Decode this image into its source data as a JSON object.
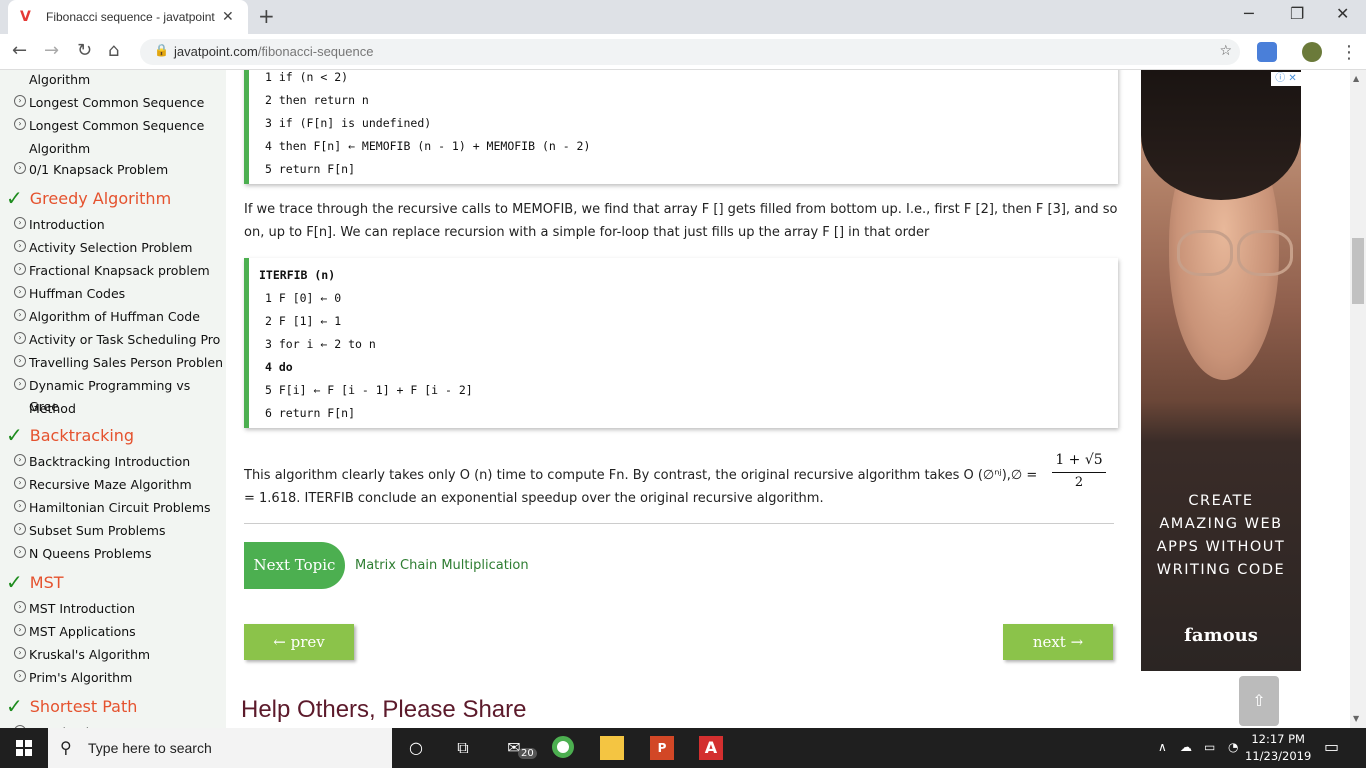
{
  "browser": {
    "tab_title": "Fibonacci sequence - javatpoint",
    "favicon": "V",
    "url_host": "javatpoint.com",
    "url_path": "/fibonacci-sequence"
  },
  "sidebar": {
    "items": [
      {
        "kind": "cont",
        "text": "Algorithm"
      },
      {
        "kind": "item",
        "text": "Longest Common Sequence"
      },
      {
        "kind": "item",
        "text": "Longest Common Sequence"
      },
      {
        "kind": "cont",
        "text": "Algorithm"
      },
      {
        "kind": "item",
        "text": "0/1 Knapsack Problem"
      },
      {
        "kind": "head",
        "text": "Greedy Algorithm"
      },
      {
        "kind": "item",
        "text": "Introduction"
      },
      {
        "kind": "item",
        "text": "Activity Selection Problem"
      },
      {
        "kind": "item",
        "text": "Fractional Knapsack problem"
      },
      {
        "kind": "item",
        "text": "Huffman Codes"
      },
      {
        "kind": "item",
        "text": "Algorithm of Huffman Code"
      },
      {
        "kind": "item",
        "text": "Activity or Task Scheduling Pro"
      },
      {
        "kind": "item",
        "text": "Travelling Sales Person Problen"
      },
      {
        "kind": "item",
        "text": "Dynamic Programming vs Gree"
      },
      {
        "kind": "cont",
        "text": "Method"
      },
      {
        "kind": "head",
        "text": "Backtracking"
      },
      {
        "kind": "item",
        "text": "Backtracking Introduction"
      },
      {
        "kind": "item",
        "text": "Recursive Maze Algorithm"
      },
      {
        "kind": "item",
        "text": "Hamiltonian Circuit Problems"
      },
      {
        "kind": "item",
        "text": "Subset Sum Problems"
      },
      {
        "kind": "item",
        "text": "N Queens Problems"
      },
      {
        "kind": "head",
        "text": "MST"
      },
      {
        "kind": "item",
        "text": "MST Introduction"
      },
      {
        "kind": "item",
        "text": "MST Applications"
      },
      {
        "kind": "item",
        "text": "Kruskal's Algorithm"
      },
      {
        "kind": "item",
        "text": "Prim's Algorithm"
      },
      {
        "kind": "head",
        "text": "Shortest Path"
      },
      {
        "kind": "item",
        "text": "Introduction"
      }
    ]
  },
  "code1": [
    "1 if (n < 2)",
    "2 then return n",
    "3 if (F[n] is undefined)",
    "4 then F[n] ← MEMOFIB (n - 1) + MEMOFIB (n - 2)",
    "5 return F[n]"
  ],
  "para1": "If we trace through the recursive calls to MEMOFIB, we find that array F [] gets filled from bottom up. I.e., first F [2], then F [3], and so on, up to F[n]. We can replace recursion with a simple for-loop that just fills up the array F [] in that order",
  "code2": {
    "title": "ITERFIB (n)",
    "lines": [
      "1 F [0] ← 0",
      "2 F [1] ← 1",
      "3 for i ← 2 to n",
      "4 do",
      "5 F[i] ← F [i - 1] + F [i - 2]",
      "6 return F[n]"
    ]
  },
  "para2": {
    "line1": "This algorithm clearly takes only O (n) time to compute Fn. By contrast, the original recursive algorithm takes O (∅ⁿʲ),∅ =",
    "line2": "= 1.618. ITERFIB conclude an exponential speedup over the original recursive algorithm.",
    "frac_num": "1 + √5",
    "frac_den": "2"
  },
  "next_topic": {
    "label": "Next Topic",
    "link": "Matrix Chain Multiplication"
  },
  "prev_label": "← prev",
  "next_label": "next →",
  "help_title": "Help Others, Please Share",
  "ad": {
    "text": [
      "CREATE",
      "AMAZING WEB",
      "APPS WITHOUT",
      "WRITING CODE"
    ],
    "brand": "famous"
  },
  "taskbar": {
    "search_placeholder": "Type here to search",
    "mail_badge": "20",
    "time": "12:17 PM",
    "date": "11/23/2019"
  }
}
